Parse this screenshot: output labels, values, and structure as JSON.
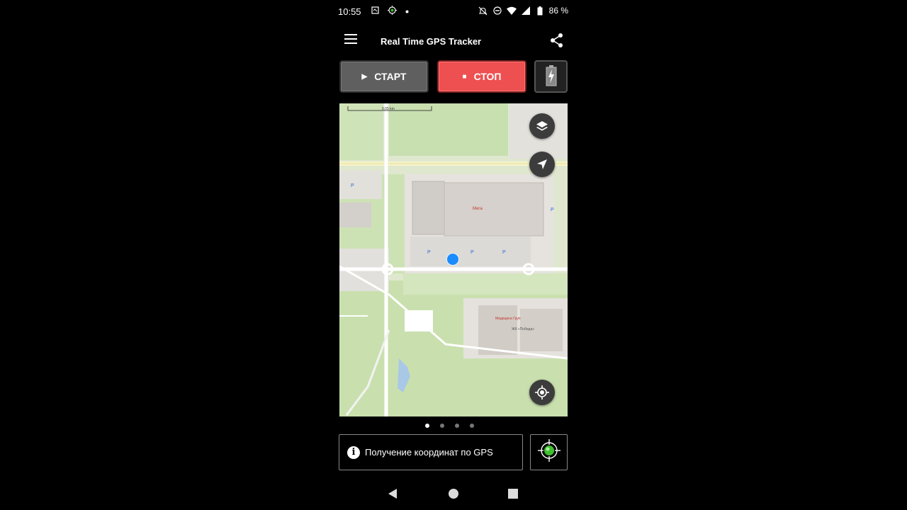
{
  "status_bar": {
    "time": "10:55",
    "battery": "86 %"
  },
  "app_bar": {
    "title": "Real Time GPS Tracker"
  },
  "controls": {
    "start_label": "СТАРТ",
    "stop_label": "СТОП"
  },
  "map": {
    "scale_label": "0,05 km",
    "poi_labels": [
      "Мега",
      "Медицина Груп",
      "ЖК «Победа»"
    ]
  },
  "pager": {
    "pages": 4,
    "active": 0
  },
  "gps": {
    "status_text": "Получение координат по GPS"
  },
  "colors": {
    "stop": "#ee4f50",
    "start": "#5f5f5f",
    "location_dot": "#1a8cff",
    "gps_indicator": "#3fbf2f"
  }
}
